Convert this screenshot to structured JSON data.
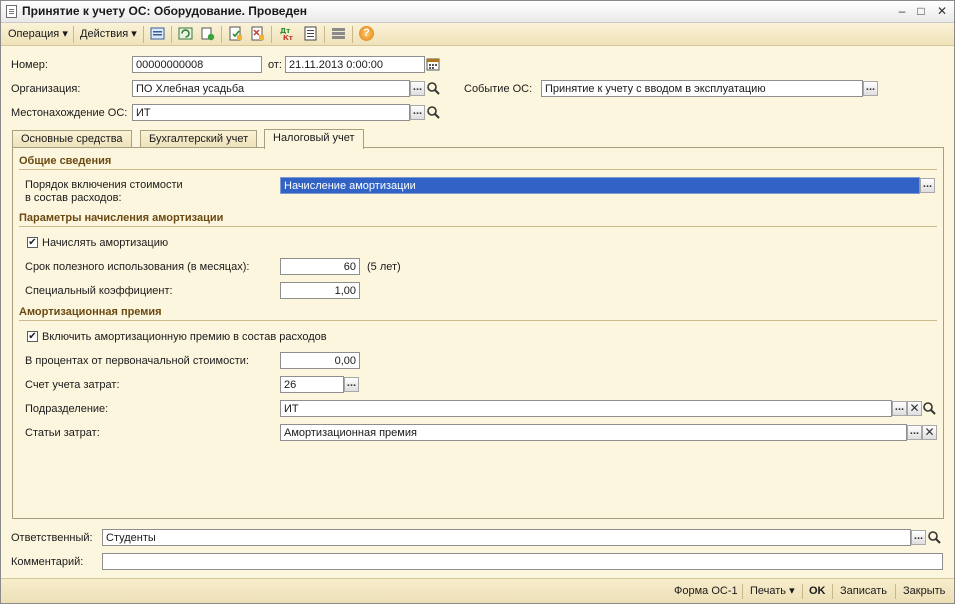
{
  "window": {
    "title": "Принятие к учету ОС: Оборудование. Проведен"
  },
  "toolbar": {
    "operation_label": "Операция",
    "actions_label": "Действия",
    "help_glyph": "?",
    "icons": [
      "list-icon",
      "refresh-icon",
      "copy-icon",
      "post-icon",
      "unpost-icon",
      "dt-kt-icon",
      "report-icon",
      "structure-icon",
      "help-icon"
    ]
  },
  "header": {
    "number_label": "Номер:",
    "number_value": "00000000008",
    "date_label": "от:",
    "date_value": "21.11.2013  0:00:00",
    "org_label": "Организация:",
    "org_value": "ПО Хлебная усадьба",
    "event_label": "Событие ОС:",
    "event_value": "Принятие к учету с вводом в эксплуатацию",
    "location_label": "Местонахождение ОС:",
    "location_value": "ИТ"
  },
  "tabs": [
    {
      "label": "Основные средства",
      "active": false
    },
    {
      "label": "Бухгалтерский учет",
      "active": false
    },
    {
      "label": "Налоговый учет",
      "active": true
    }
  ],
  "tax": {
    "general_title": "Общие сведения",
    "expense_order_label_1": "Порядок включения стоимости",
    "expense_order_label_2": "в состав расходов:",
    "expense_order_value": "Начисление амортизации",
    "depr_title": "Параметры начисления амортизации",
    "accrue_label": "Начислять амортизацию",
    "accrue_checked": true,
    "useful_life_label": "Срок полезного использования (в месяцах):",
    "useful_life_value": "60",
    "useful_life_note": "(5 лет)",
    "coef_label": "Специальный коэффициент:",
    "coef_value": "1,00",
    "bonus_title": "Амортизационная премия",
    "bonus_include_label": "Включить амортизационную премию в состав расходов",
    "bonus_include_checked": true,
    "percent_label": "В процентах от первоначальной стоимости:",
    "percent_value": "0,00",
    "cost_account_label": "Счет учета затрат:",
    "cost_account_value": "26",
    "subdivision_label": "Подразделение:",
    "subdivision_value": "ИТ",
    "cost_items_label": "Статьи затрат:",
    "cost_items_value": "Амортизационная премия"
  },
  "footer": {
    "responsible_label": "Ответственный:",
    "responsible_value": "Студенты",
    "comment_label": "Комментарий:",
    "comment_value": ""
  },
  "bottom": {
    "form_os1": "Форма ОС-1",
    "print": "Печать",
    "ok": "OK",
    "save": "Записать",
    "close": "Закрыть"
  },
  "glyphs": {
    "ellipsis": "...",
    "clear": "✕",
    "check": "✔",
    "dropdown": "▾"
  },
  "colors": {
    "form_bg": "#fdf6df",
    "section_title": "#6b4a12",
    "selection": "#3163c6"
  }
}
